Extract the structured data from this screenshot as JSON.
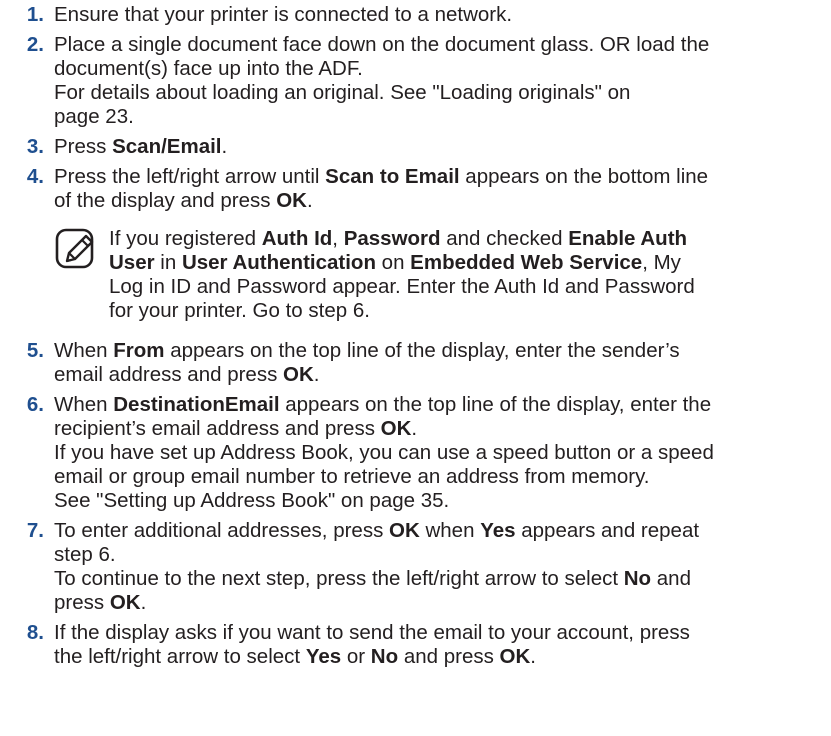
{
  "steps": [
    {
      "num": "1.",
      "lines": [
        [
          {
            "t": "Ensure that your printer is connected to a network.",
            "b": false
          }
        ]
      ]
    },
    {
      "num": "2.",
      "lines": [
        [
          {
            "t": "Place a single document face down on the document glass. OR load the",
            "b": false
          }
        ],
        [
          {
            "t": "document(s) face up into the ADF.",
            "b": false
          }
        ],
        [
          {
            "t": "For details about loading an original. See \"Loading originals\" on",
            "b": false
          }
        ],
        [
          {
            "t": "page 23.",
            "b": false
          }
        ]
      ]
    },
    {
      "num": "3.",
      "lines": [
        [
          {
            "t": "Press ",
            "b": false
          },
          {
            "t": "Scan/Email",
            "b": true
          },
          {
            "t": ".",
            "b": false
          }
        ]
      ]
    },
    {
      "num": "4.",
      "lines": [
        [
          {
            "t": "Press the left/right arrow until ",
            "b": false
          },
          {
            "t": "Scan to Email",
            "b": true
          },
          {
            "t": " appears on the bottom line",
            "b": false
          }
        ],
        [
          {
            "t": "of the display and press ",
            "b": false
          },
          {
            "t": "OK",
            "b": true
          },
          {
            "t": ".",
            "b": false
          }
        ]
      ],
      "note": {
        "icon": "note-pencil-icon",
        "lines": [
          [
            {
              "t": "If you registered ",
              "b": false
            },
            {
              "t": "Auth Id",
              "b": true
            },
            {
              "t": ", ",
              "b": false
            },
            {
              "t": "Password",
              "b": true
            },
            {
              "t": " and checked ",
              "b": false
            },
            {
              "t": "Enable Auth",
              "b": true
            }
          ],
          [
            {
              "t": "User",
              "b": true
            },
            {
              "t": " in ",
              "b": false
            },
            {
              "t": "User Authentication",
              "b": true
            },
            {
              "t": " on ",
              "b": false
            },
            {
              "t": "Embedded Web Service",
              "b": true
            },
            {
              "t": ", My",
              "b": false
            }
          ],
          [
            {
              "t": "Log in ID and Password appear. Enter the Auth Id and Password",
              "b": false
            }
          ],
          [
            {
              "t": "for your printer. Go to step 6.",
              "b": false
            }
          ]
        ]
      }
    },
    {
      "num": "5.",
      "lines": [
        [
          {
            "t": "When ",
            "b": false
          },
          {
            "t": "From",
            "b": true
          },
          {
            "t": " appears on the top line of the display, enter the sender’s",
            "b": false
          }
        ],
        [
          {
            "t": "email address and press ",
            "b": false
          },
          {
            "t": "OK",
            "b": true
          },
          {
            "t": ".",
            "b": false
          }
        ]
      ]
    },
    {
      "num": "6.",
      "lines": [
        [
          {
            "t": "When ",
            "b": false
          },
          {
            "t": "DestinationEmail",
            "b": true
          },
          {
            "t": " appears on the top line of the display, enter the",
            "b": false
          }
        ],
        [
          {
            "t": "recipient’s email address and press ",
            "b": false
          },
          {
            "t": "OK",
            "b": true
          },
          {
            "t": ".",
            "b": false
          }
        ],
        [
          {
            "t": "If you have set up Address Book, you can use a speed button or a speed",
            "b": false
          }
        ],
        [
          {
            "t": "email or group email number to retrieve an address from memory.",
            "b": false
          }
        ],
        [
          {
            "t": "See \"Setting up Address Book\" on page 35.",
            "b": false
          }
        ]
      ]
    },
    {
      "num": "7.",
      "lines": [
        [
          {
            "t": "To enter additional addresses, press ",
            "b": false
          },
          {
            "t": "OK",
            "b": true
          },
          {
            "t": " when ",
            "b": false
          },
          {
            "t": "Yes",
            "b": true
          },
          {
            "t": " appears and repeat",
            "b": false
          }
        ],
        [
          {
            "t": "step 6.",
            "b": false
          }
        ],
        [
          {
            "t": "To continue to the next step, press the left/right arrow to select ",
            "b": false
          },
          {
            "t": "No",
            "b": true
          },
          {
            "t": " and",
            "b": false
          }
        ],
        [
          {
            "t": "press ",
            "b": false
          },
          {
            "t": "OK",
            "b": true
          },
          {
            "t": ".",
            "b": false
          }
        ]
      ]
    },
    {
      "num": "8.",
      "lines": [
        [
          {
            "t": "If the display asks if you want to send the email to your account, press",
            "b": false
          }
        ],
        [
          {
            "t": "the left/right arrow to select ",
            "b": false
          },
          {
            "t": "Yes",
            "b": true
          },
          {
            "t": " or ",
            "b": false
          },
          {
            "t": "No",
            "b": true
          },
          {
            "t": " and press ",
            "b": false
          },
          {
            "t": "OK",
            "b": true
          },
          {
            "t": ".",
            "b": false
          }
        ]
      ]
    }
  ],
  "colors": {
    "text": "#231f20",
    "step_number": "#1f4f8f"
  }
}
